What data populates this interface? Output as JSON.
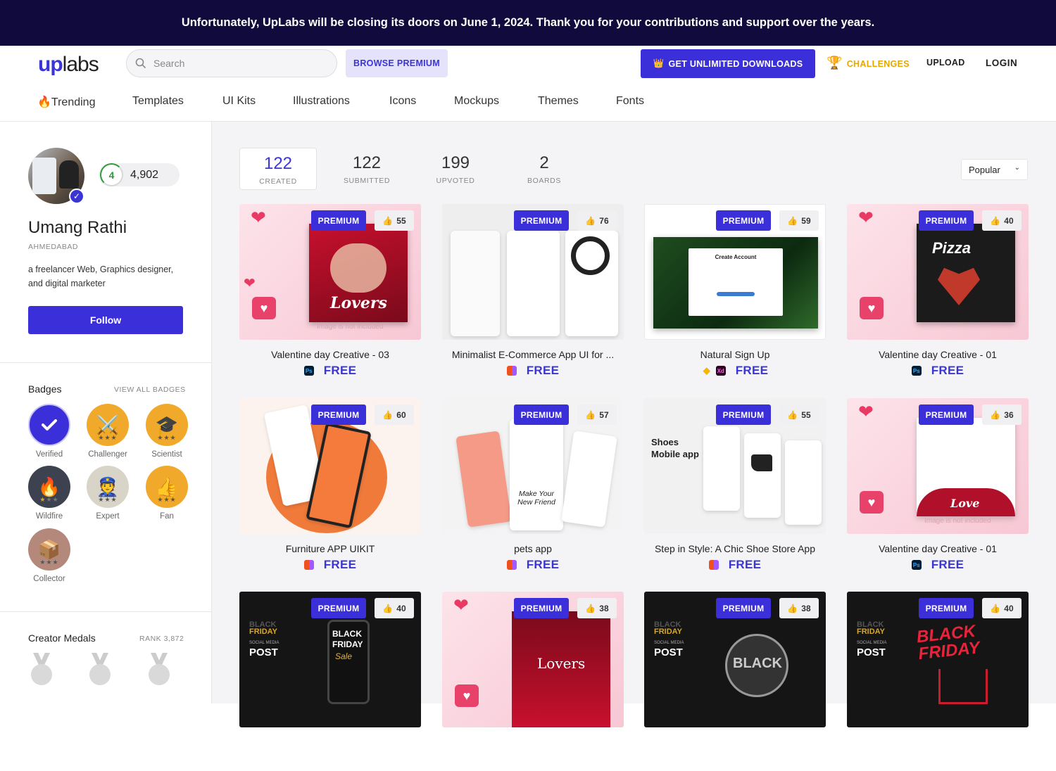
{
  "banner": {
    "text": "Unfortunately, UpLabs will be closing its doors on June 1, 2024. Thank you for your contributions and support over the years."
  },
  "header": {
    "logo_up": "up",
    "logo_labs": "labs",
    "search_placeholder": "Search",
    "browse_premium": "BROWSE PREMIUM",
    "get_unlimited": "GET UNLIMITED DOWNLOADS",
    "challenges": "CHALLENGES",
    "upload": "UPLOAD",
    "login": "LOGIN"
  },
  "categories": [
    "🔥Trending",
    "Templates",
    "UI Kits",
    "Illustrations",
    "Icons",
    "Mockups",
    "Themes",
    "Fonts"
  ],
  "profile": {
    "level": "4",
    "points": "4,902",
    "name": "Umang Rathi",
    "city": "AHMEDABAD",
    "bio": "a freelancer Web, Graphics designer, and digital marketer",
    "follow": "Follow"
  },
  "badges": {
    "title": "Badges",
    "view_all": "VIEW ALL BADGES",
    "items": [
      {
        "label": "Verified",
        "icon": "check-icon",
        "color": "#3b2fd9"
      },
      {
        "label": "Challenger",
        "icon": "trophy-icon",
        "color": "#f0a92b"
      },
      {
        "label": "Scientist",
        "icon": "graduation-cap-icon",
        "color": "#f0a92b"
      },
      {
        "label": "Wildfire",
        "icon": "fire-icon",
        "color": "#3c4250"
      },
      {
        "label": "Expert",
        "icon": "officer-icon",
        "color": "#d8d4c8"
      },
      {
        "label": "Fan",
        "icon": "thumbs-up-icon",
        "color": "#f0a92b"
      },
      {
        "label": "Collector",
        "icon": "box-icon",
        "color": "#b5887c"
      }
    ]
  },
  "medals": {
    "title": "Creator Medals",
    "rank": "RANK 3,872"
  },
  "stats": [
    {
      "num": "122",
      "label": "CREATED"
    },
    {
      "num": "122",
      "label": "SUBMITTED"
    },
    {
      "num": "199",
      "label": "UPVOTED"
    },
    {
      "num": "2",
      "label": "BOARDS"
    }
  ],
  "sort": {
    "selected": "Popular"
  },
  "card_labels": {
    "premium": "PREMIUM",
    "free": "FREE"
  },
  "cards": [
    {
      "title": "Valentine day Creative - 03",
      "likes": "55",
      "tools": [
        "ps"
      ]
    },
    {
      "title": "Minimalist E-Commerce App UI for ...",
      "likes": "76",
      "tools": [
        "fig"
      ]
    },
    {
      "title": "Natural Sign Up",
      "likes": "59",
      "tools": [
        "sketch",
        "xd"
      ]
    },
    {
      "title": "Valentine day Creative - 01",
      "likes": "40",
      "tools": [
        "ps"
      ]
    },
    {
      "title": "Furniture APP UIKIT",
      "likes": "60",
      "tools": [
        "fig"
      ]
    },
    {
      "title": "pets app",
      "likes": "57",
      "tools": [
        "fig"
      ]
    },
    {
      "title": "Step in Style: A Chic Shoe Store App",
      "likes": "55",
      "tools": [
        "fig"
      ]
    },
    {
      "title": "Valentine day Creative - 01",
      "likes": "36",
      "tools": [
        "ps"
      ]
    },
    {
      "title": "",
      "likes": "40",
      "tools": []
    },
    {
      "title": "",
      "likes": "38",
      "tools": []
    },
    {
      "title": "",
      "likes": "38",
      "tools": []
    },
    {
      "title": "",
      "likes": "40",
      "tools": []
    }
  ],
  "thumb_text": {
    "c1_title": "Lovers",
    "c4_title": "Pizza",
    "c3_title": "Create Account",
    "c6_text": "Make Your New Friend",
    "c7_text": "Shoes Mobile app",
    "c8_title": "Love",
    "c9_l1": "BLACK",
    "c9_l2": "FRIDAY",
    "c9_sub": "SOCIAL MEDIA",
    "c9_post": "POST",
    "c9_big": "BLACK FRIDAY",
    "c9_sale": "Sale",
    "c10_title": "Lovers",
    "c11_big": "BLACK",
    "c12_big": "BLACK FRIDAY",
    "c1_note": "Image is not included",
    "c8_note": "Image is not included"
  }
}
